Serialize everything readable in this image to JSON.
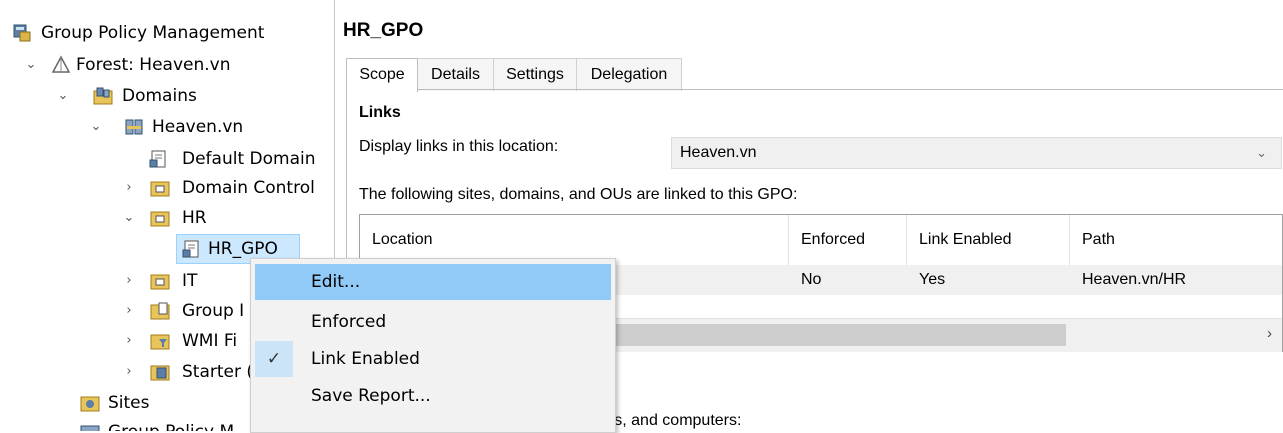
{
  "tree": {
    "root": "Group Policy Management",
    "forest": "Forest: Heaven.vn",
    "domains": "Domains",
    "domain": "Heaven.vn",
    "default_domain": "Default Domain",
    "domain_control": "Domain Control",
    "hr": "HR",
    "hr_gpo": "HR_GPO",
    "it": "IT",
    "group": "Group I",
    "wmi": "WMI Fi",
    "starter": "Starter (",
    "sites": "Sites",
    "group_policy_modeling": "Group Policy M"
  },
  "right": {
    "title": "HR_GPO",
    "tabs": [
      "Scope",
      "Details",
      "Settings",
      "Delegation"
    ],
    "links_heading": "Links",
    "display_links_label": "Display links in this location:",
    "location_value": "Heaven.vn",
    "linked_text": "The following sites, domains, and OUs are linked to this GPO:",
    "table": {
      "headers": [
        "Location",
        "Enforced",
        "Link Enabled",
        "Path"
      ],
      "row": {
        "enforced": "No",
        "link_enabled": "Yes",
        "path": "Heaven.vn/HR"
      }
    },
    "bottom_text": "y apply to the following groups, users, and computers:"
  },
  "context_menu": {
    "items": [
      "Edit...",
      "Enforced",
      "Link Enabled",
      "Save Report..."
    ],
    "checked_item": "Link Enabled",
    "highlighted_item": "Edit..."
  }
}
